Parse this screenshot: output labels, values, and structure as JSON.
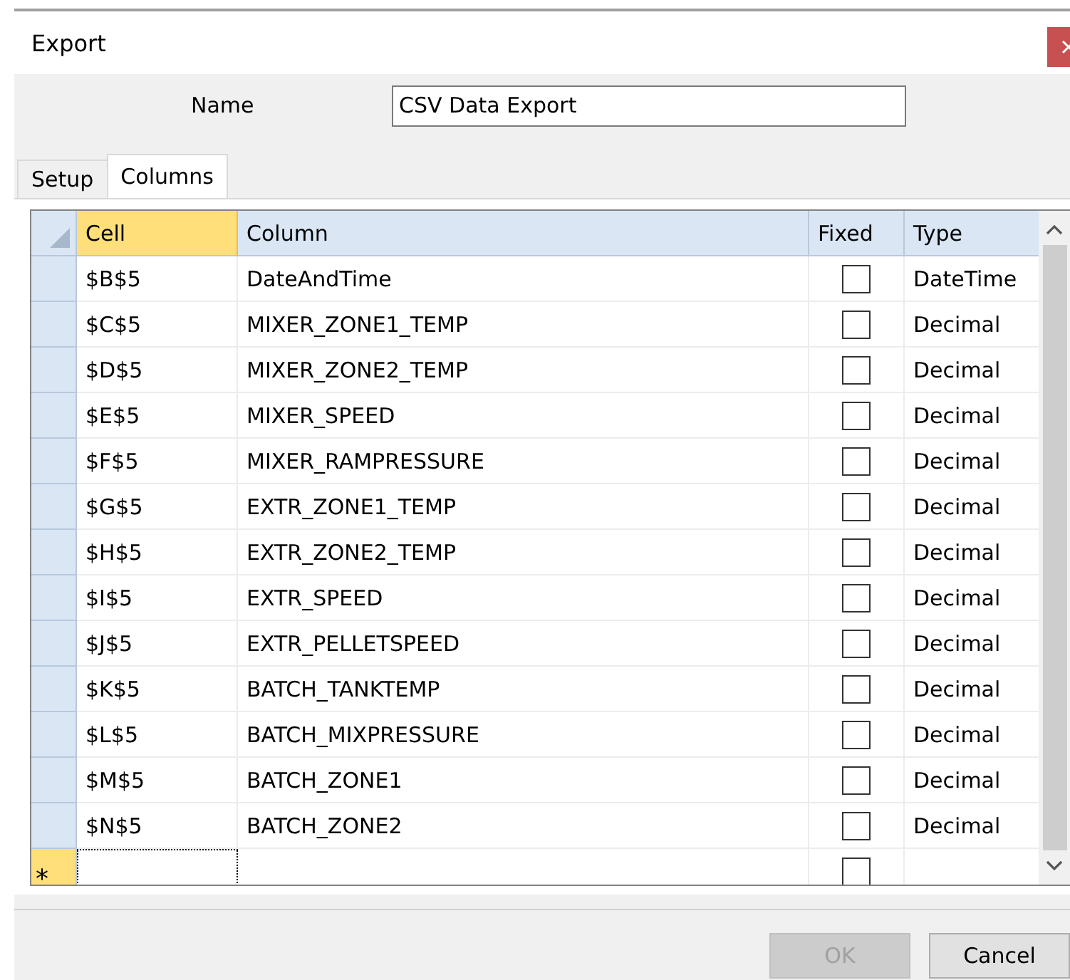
{
  "window": {
    "title": "Export",
    "close_enabled": true
  },
  "name_field": {
    "label": "Name",
    "value": "CSV Data Export"
  },
  "tabs": [
    {
      "label": "Setup",
      "selected": false
    },
    {
      "label": "Columns",
      "selected": true
    }
  ],
  "table": {
    "columns": [
      {
        "label": "Cell",
        "selected": true
      },
      {
        "label": "Column",
        "selected": false
      },
      {
        "label": "Fixed",
        "selected": false
      },
      {
        "label": "Type",
        "selected": false
      }
    ],
    "rows": [
      {
        "cell": "$B$5",
        "column": "DateAndTime",
        "fixed": false,
        "type": "DateTime"
      },
      {
        "cell": "$C$5",
        "column": "MIXER_ZONE1_TEMP",
        "fixed": false,
        "type": "Decimal"
      },
      {
        "cell": "$D$5",
        "column": "MIXER_ZONE2_TEMP",
        "fixed": false,
        "type": "Decimal"
      },
      {
        "cell": "$E$5",
        "column": "MIXER_SPEED",
        "fixed": false,
        "type": "Decimal"
      },
      {
        "cell": "$F$5",
        "column": "MIXER_RAMPRESSURE",
        "fixed": false,
        "type": "Decimal"
      },
      {
        "cell": "$G$5",
        "column": "EXTR_ZONE1_TEMP",
        "fixed": false,
        "type": "Decimal"
      },
      {
        "cell": "$H$5",
        "column": "EXTR_ZONE2_TEMP",
        "fixed": false,
        "type": "Decimal"
      },
      {
        "cell": "$I$5",
        "column": "EXTR_SPEED",
        "fixed": false,
        "type": "Decimal"
      },
      {
        "cell": "$J$5",
        "column": "EXTR_PELLETSPEED",
        "fixed": false,
        "type": "Decimal"
      },
      {
        "cell": "$K$5",
        "column": "BATCH_TANKTEMP",
        "fixed": false,
        "type": "Decimal"
      },
      {
        "cell": "$L$5",
        "column": "BATCH_MIXPRESSURE",
        "fixed": false,
        "type": "Decimal"
      },
      {
        "cell": "$M$5",
        "column": "BATCH_ZONE1",
        "fixed": false,
        "type": "Decimal"
      },
      {
        "cell": "$N$5",
        "column": "BATCH_ZONE2",
        "fixed": false,
        "type": "Decimal"
      }
    ],
    "new_row": {
      "marker": "*",
      "fixed": false
    }
  },
  "buttons": [
    {
      "label": "OK",
      "disabled": true
    },
    {
      "label": "Cancel",
      "disabled": false
    }
  ]
}
